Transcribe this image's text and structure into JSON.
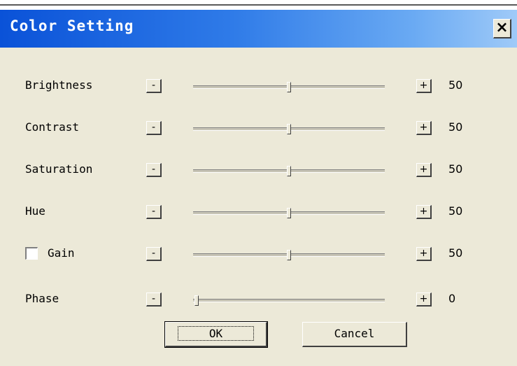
{
  "dialog": {
    "title": "Color Setting",
    "close_label": "×",
    "minus_label": "-",
    "plus_label": "+",
    "rows": [
      {
        "label": "Brightness",
        "value": "50",
        "min": 0,
        "max": 100,
        "position": 50
      },
      {
        "label": "Contrast",
        "value": "50",
        "min": 0,
        "max": 100,
        "position": 50
      },
      {
        "label": "Saturation",
        "value": "50",
        "min": 0,
        "max": 100,
        "position": 50
      },
      {
        "label": "Hue",
        "value": "50",
        "min": 0,
        "max": 100,
        "position": 50
      },
      {
        "label": "Gain",
        "value": "50",
        "min": 0,
        "max": 100,
        "position": 50,
        "checked": false
      },
      {
        "label": "Phase",
        "value": "0",
        "min": 0,
        "max": 100,
        "position": 0
      }
    ],
    "ok_label": "OK",
    "cancel_label": "Cancel"
  },
  "colors": {
    "title_bar": "#0a52d8",
    "dialog_bg": "#ece9d8"
  }
}
